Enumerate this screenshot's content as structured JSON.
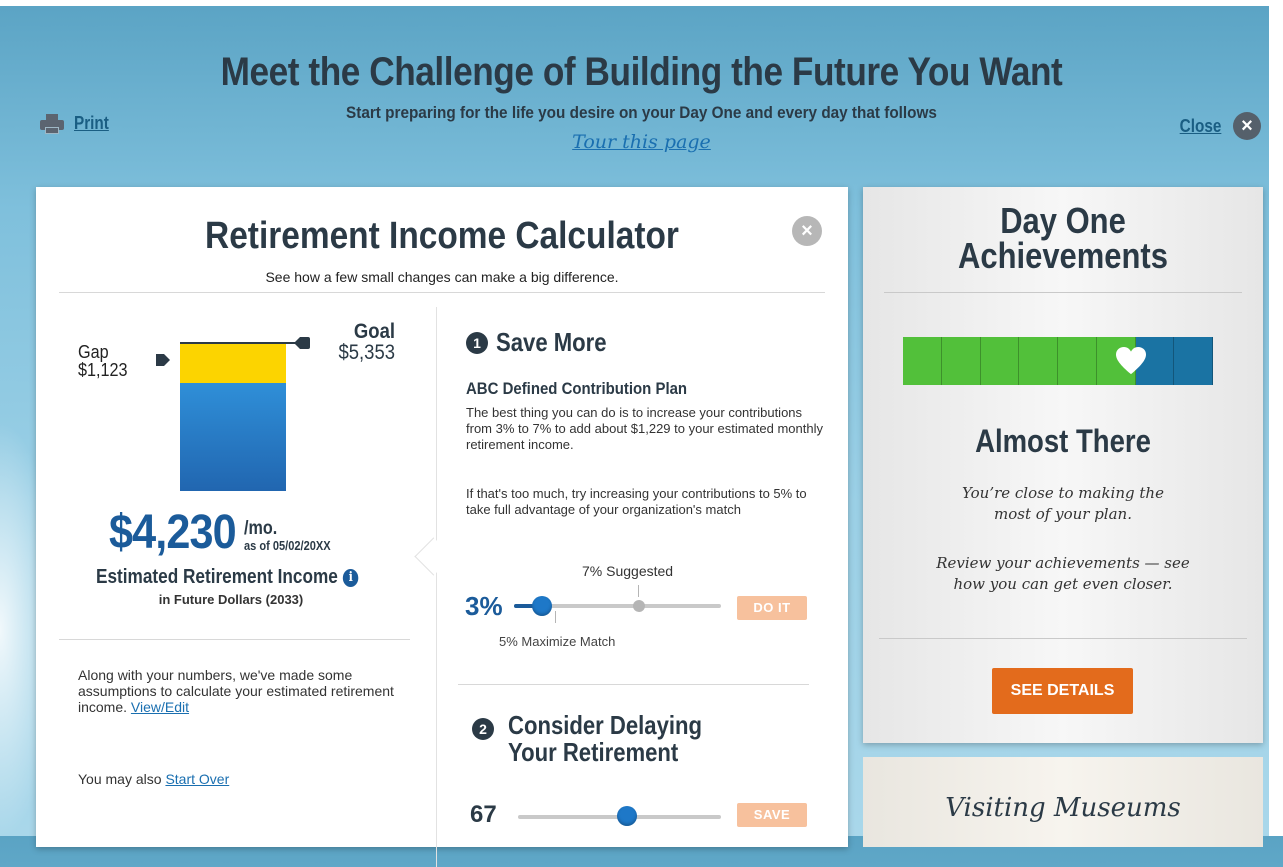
{
  "header": {
    "title": "Meet the Challenge of Building the Future You Want",
    "subtitle": "Start preparing for the life you desire on your Day One and every day that follows",
    "tour_link": "Tour this page",
    "print_label": "Print",
    "close_label": "Close"
  },
  "calculator": {
    "title": "Retirement Income Calculator",
    "subtitle": "See how a few small changes can make a big difference.",
    "chart": {
      "gap_label": "Gap",
      "gap_value": "$1,123",
      "goal_label": "Goal",
      "goal_value": "$5,353",
      "gap_amount": 1123,
      "income_amount": 4230,
      "goal_amount": 5353
    },
    "income": {
      "amount": "$4,230",
      "per": "/mo.",
      "as_of": "as of 05/02/20XX",
      "label": "Estimated Retirement Income",
      "sublabel": "in Future Dollars (2033)"
    },
    "assumptions": {
      "text": "Along with your numbers, we've made some assumptions to calculate your estimated retirement income.",
      "link": "View/Edit",
      "also_text": "You may also",
      "start_over": "Start Over"
    },
    "save_more": {
      "number": "1",
      "title": "Save More",
      "plan": "ABC Defined Contribution Plan",
      "para1": "The best thing you can do is to increase your contributions from 3% to 7% to add about $1,229 to your estimated monthly retirement income.",
      "para2": "If that's too much, try increasing your contributions to 5% to take full advantage of your organization's match",
      "suggested_label": "7% Suggested",
      "current_value": "3%",
      "match_label": "5% Maximize Match",
      "button": "DO IT"
    },
    "delay": {
      "number": "2",
      "title_line1": "Consider Delaying",
      "title_line2": "Your Retirement",
      "current_value": "67",
      "button": "SAVE"
    }
  },
  "achievements": {
    "title_line1": "Day One",
    "title_line2": "Achievements",
    "progress": {
      "filled_segments": 6,
      "total_segments": 8
    },
    "status": "Almost There",
    "text1_line1": "You’re close to making the",
    "text1_line2": "most of your plan.",
    "text2_line1": "Review your achievements — see",
    "text2_line2": "how you can get even closer.",
    "button": "SEE DETAILS"
  },
  "next_card": {
    "title": "Visiting Museums"
  },
  "colors": {
    "accent": "#1b5b9a",
    "gap": "#fcd400",
    "progress_green": "#52c03a",
    "progress_blue": "#1a73a3",
    "cta": "#e36b1c"
  }
}
